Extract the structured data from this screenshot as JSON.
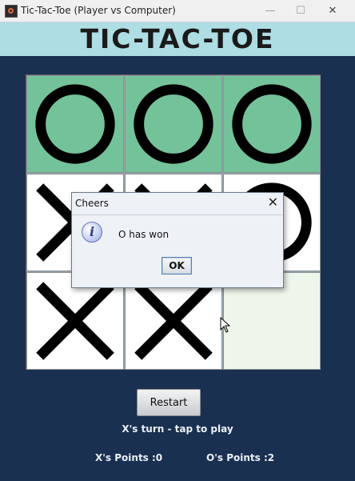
{
  "window": {
    "title": "Tic-Tac-Toe (Player vs Computer)"
  },
  "banner": {
    "title": "TIC-TAC-TOE"
  },
  "board": {
    "cells": [
      {
        "mark": "O",
        "win": true
      },
      {
        "mark": "O",
        "win": true
      },
      {
        "mark": "O",
        "win": true
      },
      {
        "mark": "X",
        "win": false
      },
      {
        "mark": "X",
        "win": false
      },
      {
        "mark": "O",
        "win": false
      },
      {
        "mark": "X",
        "win": false
      },
      {
        "mark": "X",
        "win": false
      },
      {
        "mark": "",
        "win": false
      }
    ],
    "colors": {
      "win_bg": "#74c29a",
      "normal_bg": "#ffffff",
      "empty_bg": "#eef6ec",
      "mark": "#000000"
    }
  },
  "controls": {
    "restart_label": "Restart"
  },
  "status": {
    "turn_text": "X's turn - tap to play"
  },
  "score": {
    "x_text": "X's Points :0",
    "o_text": "O's Points :2"
  },
  "dialog": {
    "title": "Cheers",
    "message": "O has won",
    "ok_label": "OK"
  }
}
